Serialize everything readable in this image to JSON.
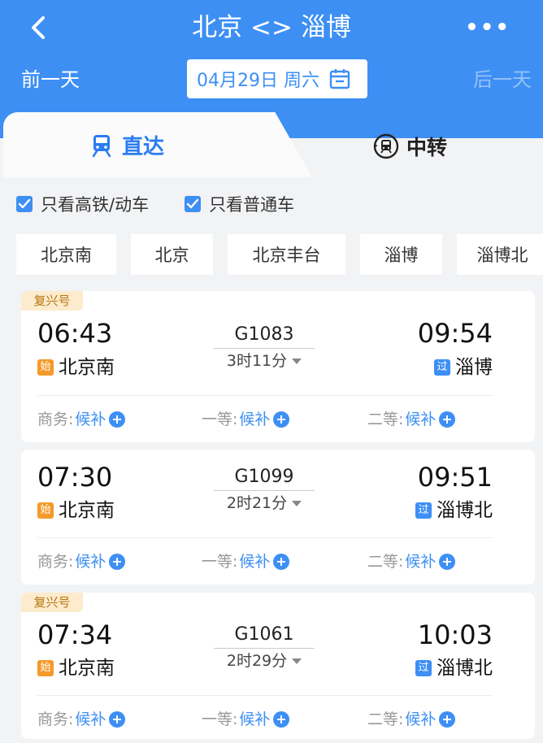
{
  "header": {
    "title": "北京 <> 淄博",
    "more": "•••",
    "prev_day": "前一天",
    "next_day": "后一天",
    "date": "04月29日 周六"
  },
  "tabs": [
    {
      "label": "直达"
    },
    {
      "label": "中转"
    }
  ],
  "filters": [
    {
      "label": "只看高铁/动车",
      "checked": true
    },
    {
      "label": "只看普通车",
      "checked": true
    }
  ],
  "stations": [
    "北京南",
    "北京",
    "北京丰台",
    "淄博",
    "淄博北"
  ],
  "trains": [
    {
      "badge": "复兴号",
      "dep_time": "06:43",
      "dep_tag": "始",
      "dep_station": "北京南",
      "train_no": "G1083",
      "duration": "3时11分",
      "arr_time": "09:54",
      "arr_tag": "过",
      "arr_station": "淄博",
      "seats": [
        {
          "class": "商务:",
          "status": "候补"
        },
        {
          "class": "一等:",
          "status": "候补"
        },
        {
          "class": "二等:",
          "status": "候补"
        }
      ]
    },
    {
      "badge": "",
      "dep_time": "07:30",
      "dep_tag": "始",
      "dep_station": "北京南",
      "train_no": "G1099",
      "duration": "2时21分",
      "arr_time": "09:51",
      "arr_tag": "过",
      "arr_station": "淄博北",
      "seats": [
        {
          "class": "商务:",
          "status": "候补"
        },
        {
          "class": "一等:",
          "status": "候补"
        },
        {
          "class": "二等:",
          "status": "候补"
        }
      ]
    },
    {
      "badge": "复兴号",
      "dep_time": "07:34",
      "dep_tag": "始",
      "dep_station": "北京南",
      "train_no": "G1061",
      "duration": "2时29分",
      "arr_time": "10:03",
      "arr_tag": "过",
      "arr_station": "淄博北",
      "seats": [
        {
          "class": "商务:",
          "status": "候补"
        },
        {
          "class": "一等:",
          "status": "候补"
        },
        {
          "class": "二等:",
          "status": "候补"
        }
      ]
    }
  ],
  "colors": {
    "primary": "#3d8ff4",
    "badge_bg": "#fcebcd",
    "badge_text": "#b8730a",
    "start_tag": "#f49a2a"
  }
}
